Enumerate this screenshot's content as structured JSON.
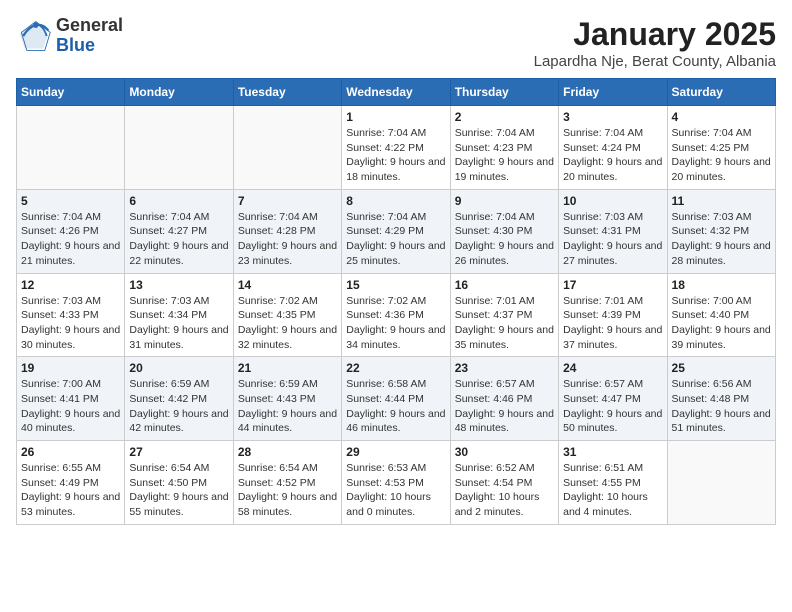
{
  "logo": {
    "general": "General",
    "blue": "Blue"
  },
  "header": {
    "month": "January 2025",
    "location": "Lapardha Nje, Berat County, Albania"
  },
  "weekdays": [
    "Sunday",
    "Monday",
    "Tuesday",
    "Wednesday",
    "Thursday",
    "Friday",
    "Saturday"
  ],
  "weeks": [
    [
      {
        "day": "",
        "sunrise": "",
        "sunset": "",
        "daylight": ""
      },
      {
        "day": "",
        "sunrise": "",
        "sunset": "",
        "daylight": ""
      },
      {
        "day": "",
        "sunrise": "",
        "sunset": "",
        "daylight": ""
      },
      {
        "day": "1",
        "sunrise": "Sunrise: 7:04 AM",
        "sunset": "Sunset: 4:22 PM",
        "daylight": "Daylight: 9 hours and 18 minutes."
      },
      {
        "day": "2",
        "sunrise": "Sunrise: 7:04 AM",
        "sunset": "Sunset: 4:23 PM",
        "daylight": "Daylight: 9 hours and 19 minutes."
      },
      {
        "day": "3",
        "sunrise": "Sunrise: 7:04 AM",
        "sunset": "Sunset: 4:24 PM",
        "daylight": "Daylight: 9 hours and 20 minutes."
      },
      {
        "day": "4",
        "sunrise": "Sunrise: 7:04 AM",
        "sunset": "Sunset: 4:25 PM",
        "daylight": "Daylight: 9 hours and 20 minutes."
      }
    ],
    [
      {
        "day": "5",
        "sunrise": "Sunrise: 7:04 AM",
        "sunset": "Sunset: 4:26 PM",
        "daylight": "Daylight: 9 hours and 21 minutes."
      },
      {
        "day": "6",
        "sunrise": "Sunrise: 7:04 AM",
        "sunset": "Sunset: 4:27 PM",
        "daylight": "Daylight: 9 hours and 22 minutes."
      },
      {
        "day": "7",
        "sunrise": "Sunrise: 7:04 AM",
        "sunset": "Sunset: 4:28 PM",
        "daylight": "Daylight: 9 hours and 23 minutes."
      },
      {
        "day": "8",
        "sunrise": "Sunrise: 7:04 AM",
        "sunset": "Sunset: 4:29 PM",
        "daylight": "Daylight: 9 hours and 25 minutes."
      },
      {
        "day": "9",
        "sunrise": "Sunrise: 7:04 AM",
        "sunset": "Sunset: 4:30 PM",
        "daylight": "Daylight: 9 hours and 26 minutes."
      },
      {
        "day": "10",
        "sunrise": "Sunrise: 7:03 AM",
        "sunset": "Sunset: 4:31 PM",
        "daylight": "Daylight: 9 hours and 27 minutes."
      },
      {
        "day": "11",
        "sunrise": "Sunrise: 7:03 AM",
        "sunset": "Sunset: 4:32 PM",
        "daylight": "Daylight: 9 hours and 28 minutes."
      }
    ],
    [
      {
        "day": "12",
        "sunrise": "Sunrise: 7:03 AM",
        "sunset": "Sunset: 4:33 PM",
        "daylight": "Daylight: 9 hours and 30 minutes."
      },
      {
        "day": "13",
        "sunrise": "Sunrise: 7:03 AM",
        "sunset": "Sunset: 4:34 PM",
        "daylight": "Daylight: 9 hours and 31 minutes."
      },
      {
        "day": "14",
        "sunrise": "Sunrise: 7:02 AM",
        "sunset": "Sunset: 4:35 PM",
        "daylight": "Daylight: 9 hours and 32 minutes."
      },
      {
        "day": "15",
        "sunrise": "Sunrise: 7:02 AM",
        "sunset": "Sunset: 4:36 PM",
        "daylight": "Daylight: 9 hours and 34 minutes."
      },
      {
        "day": "16",
        "sunrise": "Sunrise: 7:01 AM",
        "sunset": "Sunset: 4:37 PM",
        "daylight": "Daylight: 9 hours and 35 minutes."
      },
      {
        "day": "17",
        "sunrise": "Sunrise: 7:01 AM",
        "sunset": "Sunset: 4:39 PM",
        "daylight": "Daylight: 9 hours and 37 minutes."
      },
      {
        "day": "18",
        "sunrise": "Sunrise: 7:00 AM",
        "sunset": "Sunset: 4:40 PM",
        "daylight": "Daylight: 9 hours and 39 minutes."
      }
    ],
    [
      {
        "day": "19",
        "sunrise": "Sunrise: 7:00 AM",
        "sunset": "Sunset: 4:41 PM",
        "daylight": "Daylight: 9 hours and 40 minutes."
      },
      {
        "day": "20",
        "sunrise": "Sunrise: 6:59 AM",
        "sunset": "Sunset: 4:42 PM",
        "daylight": "Daylight: 9 hours and 42 minutes."
      },
      {
        "day": "21",
        "sunrise": "Sunrise: 6:59 AM",
        "sunset": "Sunset: 4:43 PM",
        "daylight": "Daylight: 9 hours and 44 minutes."
      },
      {
        "day": "22",
        "sunrise": "Sunrise: 6:58 AM",
        "sunset": "Sunset: 4:44 PM",
        "daylight": "Daylight: 9 hours and 46 minutes."
      },
      {
        "day": "23",
        "sunrise": "Sunrise: 6:57 AM",
        "sunset": "Sunset: 4:46 PM",
        "daylight": "Daylight: 9 hours and 48 minutes."
      },
      {
        "day": "24",
        "sunrise": "Sunrise: 6:57 AM",
        "sunset": "Sunset: 4:47 PM",
        "daylight": "Daylight: 9 hours and 50 minutes."
      },
      {
        "day": "25",
        "sunrise": "Sunrise: 6:56 AM",
        "sunset": "Sunset: 4:48 PM",
        "daylight": "Daylight: 9 hours and 51 minutes."
      }
    ],
    [
      {
        "day": "26",
        "sunrise": "Sunrise: 6:55 AM",
        "sunset": "Sunset: 4:49 PM",
        "daylight": "Daylight: 9 hours and 53 minutes."
      },
      {
        "day": "27",
        "sunrise": "Sunrise: 6:54 AM",
        "sunset": "Sunset: 4:50 PM",
        "daylight": "Daylight: 9 hours and 55 minutes."
      },
      {
        "day": "28",
        "sunrise": "Sunrise: 6:54 AM",
        "sunset": "Sunset: 4:52 PM",
        "daylight": "Daylight: 9 hours and 58 minutes."
      },
      {
        "day": "29",
        "sunrise": "Sunrise: 6:53 AM",
        "sunset": "Sunset: 4:53 PM",
        "daylight": "Daylight: 10 hours and 0 minutes."
      },
      {
        "day": "30",
        "sunrise": "Sunrise: 6:52 AM",
        "sunset": "Sunset: 4:54 PM",
        "daylight": "Daylight: 10 hours and 2 minutes."
      },
      {
        "day": "31",
        "sunrise": "Sunrise: 6:51 AM",
        "sunset": "Sunset: 4:55 PM",
        "daylight": "Daylight: 10 hours and 4 minutes."
      },
      {
        "day": "",
        "sunrise": "",
        "sunset": "",
        "daylight": ""
      }
    ]
  ]
}
